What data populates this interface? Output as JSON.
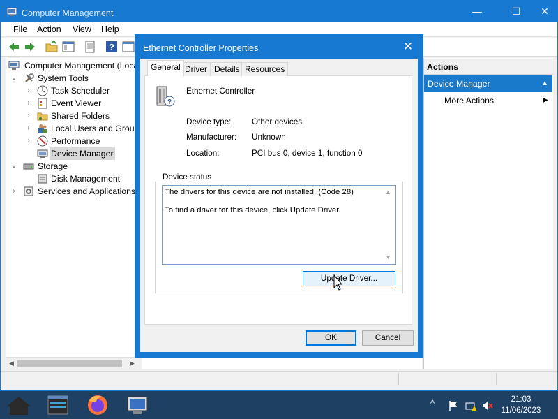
{
  "main_window": {
    "title": "Computer Management",
    "controls": {
      "minimize": "—",
      "maximize": "☐",
      "close": "✕"
    }
  },
  "menu": {
    "items": [
      "File",
      "Action",
      "View",
      "Help"
    ]
  },
  "tree": {
    "root": "Computer Management (Loca",
    "items": [
      {
        "label": "System Tools",
        "expander": "⌄",
        "icon": "tools-icon"
      },
      {
        "label": "Task Scheduler",
        "expander": "›",
        "icon": "clock-icon"
      },
      {
        "label": "Event Viewer",
        "expander": "›",
        "icon": "event-viewer-icon"
      },
      {
        "label": "Shared Folders",
        "expander": "›",
        "icon": "shared-folder-icon"
      },
      {
        "label": "Local Users and Groups",
        "expander": "›",
        "icon": "users-icon"
      },
      {
        "label": "Performance",
        "expander": "›",
        "icon": "performance-icon"
      },
      {
        "label": "Device Manager",
        "expander": "",
        "icon": "device-manager-icon",
        "selected": true
      },
      {
        "label": "Storage",
        "expander": "⌄",
        "icon": "storage-icon"
      },
      {
        "label": "Disk Management",
        "expander": "",
        "icon": "disk-icon"
      },
      {
        "label": "Services and Applications",
        "expander": "›",
        "icon": "services-icon"
      }
    ]
  },
  "actions": {
    "header": "Actions",
    "section": "Device Manager",
    "section_caret": "▲",
    "more": "More Actions",
    "more_arrow": "▶"
  },
  "dialog": {
    "title": "Ethernet Controller Properties",
    "close": "✕",
    "tabs": [
      "General",
      "Driver",
      "Details",
      "Resources"
    ],
    "active_tab": "General",
    "device_name": "Ethernet Controller",
    "properties": [
      {
        "label": "Device type:",
        "value": "Other devices"
      },
      {
        "label": "Manufacturer:",
        "value": "Unknown"
      },
      {
        "label": "Location:",
        "value": "PCI bus 0, device 1, function 0"
      }
    ],
    "status_group": "Device status",
    "status_line1": "The drivers for this device are not installed. (Code 28)",
    "status_line2": "To find a driver for this device, click Update Driver.",
    "update_button": "Update Driver...",
    "ok_button": "OK",
    "cancel_button": "Cancel"
  },
  "taskbar": {
    "apps": [
      "start-icon",
      "terminal-icon",
      "firefox-icon",
      "computer-management-icon"
    ],
    "tray_caret": "^",
    "time": "21:03",
    "date": "11/06/2023"
  },
  "colors": {
    "title_blue": "#1779d2",
    "selection_blue": "#1979ca",
    "taskbar": "#1d4063"
  }
}
